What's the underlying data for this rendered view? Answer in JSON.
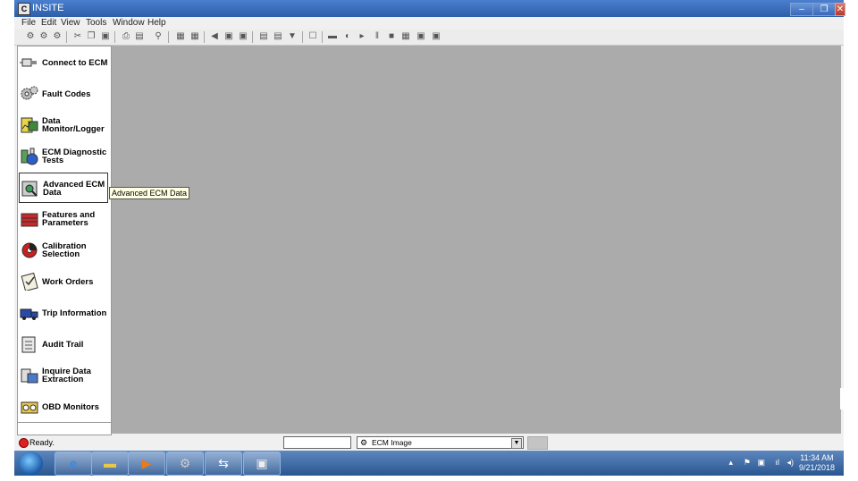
{
  "window": {
    "title": "INSITE",
    "icon_text": "C"
  },
  "menu": [
    "File",
    "Edit",
    "View",
    "Tools",
    "Window",
    "Help"
  ],
  "toolbar_icons": [
    "connect-icon",
    "disconnect-icon",
    "reconnect-icon",
    "cut-icon",
    "copy-icon",
    "paste-icon",
    "print-icon",
    "print-preview-icon",
    "find-icon",
    "properties-icon",
    "calendar-icon",
    "back-icon",
    "refresh-icon",
    "save-icon",
    "doc-icon",
    "open-icon",
    "filter-icon",
    "new-icon",
    "monitor-icon",
    "record-icon",
    "play-icon",
    "pause-icon",
    "stop-icon",
    "grid-icon",
    "export-icon",
    "import-icon"
  ],
  "sidebar": {
    "items": [
      {
        "label": "Connect to ECM",
        "icon": "plug-icon"
      },
      {
        "label": "Fault Codes",
        "icon": "gears-icon"
      },
      {
        "label": "Data\nMonitor/Logger",
        "icon": "monitor-logger-icon"
      },
      {
        "label": "ECM Diagnostic\nTests",
        "icon": "flask-icon"
      },
      {
        "label": "Advanced ECM\nData",
        "icon": "magnifier-chip-icon"
      },
      {
        "label": "Features and\nParameters",
        "icon": "toolbox-icon"
      },
      {
        "label": "Calibration\nSelection",
        "icon": "disc-icon"
      },
      {
        "label": "Work Orders",
        "icon": "clipboard-icon"
      },
      {
        "label": "Trip Information",
        "icon": "truck-icon"
      },
      {
        "label": "Audit Trail",
        "icon": "document-icon"
      },
      {
        "label": "Inquire Data\nExtraction",
        "icon": "extraction-icon"
      },
      {
        "label": "OBD Monitors",
        "icon": "obd-icon"
      }
    ],
    "selected_index": 4
  },
  "tooltip": "Advanced ECM Data",
  "status": {
    "text": "Ready.",
    "combo_value": "ECM Image",
    "dot_color": "#dd2222"
  },
  "taskbar": {
    "pinned": [
      "ie-icon",
      "explorer-icon",
      "media-player-icon",
      "control-panel-icon",
      "teamviewer-icon",
      "insite-icon"
    ],
    "time": "11:34 AM",
    "date": "9/21/2018"
  },
  "colors": {
    "workarea": "#ababab",
    "titlebar": "#2c5ea8",
    "taskbar": "#2a5690"
  }
}
